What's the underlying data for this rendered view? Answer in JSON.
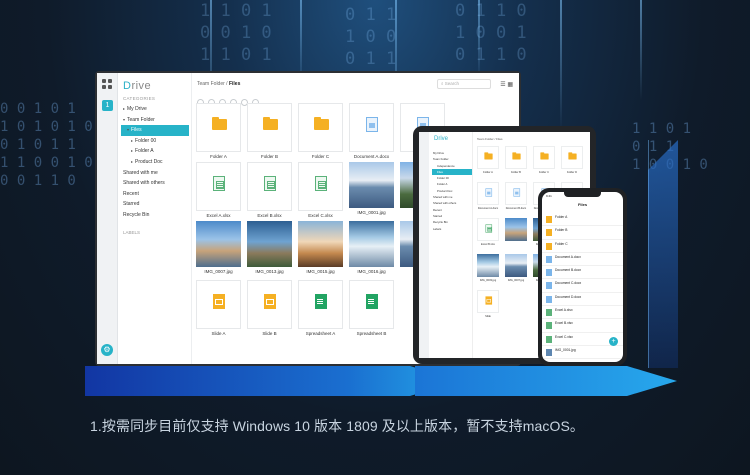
{
  "caption": "1.按需同步目前仅支持 Windows 10 版本 1809 及以上版本，暂不支持macOS。",
  "colors": {
    "accent": "#27b3c8",
    "folder": "#f5b023",
    "doc": "#7bb5ea",
    "xls": "#5bb27a",
    "sheet": "#22a463"
  },
  "desktop": {
    "logo_d": "D",
    "logo_rest": "rive",
    "rail_badge": "1",
    "categories_label": "CATEGORIES",
    "labels_label": "LABELS",
    "tree": [
      {
        "label": "My Drive",
        "caret": "▸"
      },
      {
        "label": "Team Folder",
        "caret": "▾"
      },
      {
        "label": "Files",
        "caret": "▾"
      },
      {
        "label": "Folder 00",
        "caret": "▸"
      },
      {
        "label": "Folder A",
        "caret": "▸"
      },
      {
        "label": "Product Doc",
        "caret": "▸"
      },
      {
        "label": "Shared with me",
        "caret": ""
      },
      {
        "label": "Shared with others",
        "caret": ""
      },
      {
        "label": "Recent",
        "caret": ""
      },
      {
        "label": "Starred",
        "caret": ""
      },
      {
        "label": "Recycle Bin",
        "caret": ""
      }
    ],
    "crumb_parent": "Team Folder",
    "crumb_sep": " / ",
    "crumb_current": "Files",
    "search_placeholder": "Search",
    "tiles": [
      {
        "name": "Folder A",
        "kind": "folder"
      },
      {
        "name": "Folder B",
        "kind": "folder"
      },
      {
        "name": "Folder C",
        "kind": "folder"
      },
      {
        "name": "Document A.docx",
        "kind": "doc"
      },
      {
        "name": "Doc",
        "kind": "doc"
      },
      {
        "name": "Excel A.xlsx",
        "kind": "xls"
      },
      {
        "name": "Excel B.xlsx",
        "kind": "xls"
      },
      {
        "name": "Excel C.xlsx",
        "kind": "xls"
      },
      {
        "name": "IMG_0001.jpg",
        "kind": "photo"
      },
      {
        "name": "IM",
        "kind": "photo"
      },
      {
        "name": "IMG_0007.jpg",
        "kind": "photo"
      },
      {
        "name": "IMG_0013.jpg",
        "kind": "photo"
      },
      {
        "name": "IMG_0015.jpg",
        "kind": "photo"
      },
      {
        "name": "IMG_0016.jpg",
        "kind": "photo"
      },
      {
        "name": "",
        "kind": "photo"
      },
      {
        "name": "Slide A",
        "kind": "slide"
      },
      {
        "name": "Slide B",
        "kind": "slide"
      },
      {
        "name": "Spreadsheet A",
        "kind": "sheet"
      },
      {
        "name": "Spreadsheet B",
        "kind": "sheet"
      }
    ]
  },
  "tablet": {
    "logo": "Drive",
    "crumb": "Team Folder / Files",
    "tree": [
      "My Drive",
      "Team Folder",
      "Independence",
      "Files",
      "Folder 00",
      "Folder A",
      "Product Doc",
      "Shared with me",
      "Shared with others",
      "Recent",
      "Starred",
      "Recycle Bin",
      "Labels"
    ],
    "tiles": [
      {
        "name": "Folder A",
        "kind": "folder"
      },
      {
        "name": "Folder B",
        "kind": "folder"
      },
      {
        "name": "Folder C",
        "kind": "folder"
      },
      {
        "name": "Folder D",
        "kind": "folder"
      },
      {
        "name": "Document A.docx",
        "kind": "doc"
      },
      {
        "name": "Document B.docx",
        "kind": "doc"
      },
      {
        "name": "Document C.docx",
        "kind": "doc"
      },
      {
        "name": "Excel A.xlsx",
        "kind": "xls"
      },
      {
        "name": "Excel B.xlsx",
        "kind": "xls"
      },
      {
        "name": "",
        "kind": "photo"
      },
      {
        "name": "IMG_0001.jpg",
        "kind": "photo"
      },
      {
        "name": "IMG_0002.jpg",
        "kind": "photo"
      },
      {
        "name": "IMG_0003.jpg",
        "kind": "photo"
      },
      {
        "name": "IMG_0007.jpg",
        "kind": "photo"
      },
      {
        "name": "IMG_0013.jpg",
        "kind": "photo"
      },
      {
        "name": "Office Document",
        "kind": "doc"
      },
      {
        "name": "Slide",
        "kind": "slide"
      }
    ]
  },
  "phone": {
    "status_time": "9:41",
    "title": "Files",
    "rows": [
      {
        "name": "Folder A",
        "sub": "",
        "kind": "folder"
      },
      {
        "name": "Folder B",
        "sub": "",
        "kind": "folder"
      },
      {
        "name": "Folder C",
        "sub": "",
        "kind": "folder"
      },
      {
        "name": "Document A.docx",
        "sub": "",
        "kind": "doc"
      },
      {
        "name": "Document B.docx",
        "sub": "",
        "kind": "doc"
      },
      {
        "name": "Document C.docx",
        "sub": "",
        "kind": "doc"
      },
      {
        "name": "Document D.docx",
        "sub": "",
        "kind": "doc"
      },
      {
        "name": "Excel A.xlsx",
        "sub": "",
        "kind": "xls"
      },
      {
        "name": "Excel B.xlsx",
        "sub": "",
        "kind": "xls"
      },
      {
        "name": "Excel C.xlsx",
        "sub": "",
        "kind": "xls"
      },
      {
        "name": "IMG_0001.jpg",
        "sub": "",
        "kind": "photo"
      }
    ],
    "fab": "+"
  }
}
